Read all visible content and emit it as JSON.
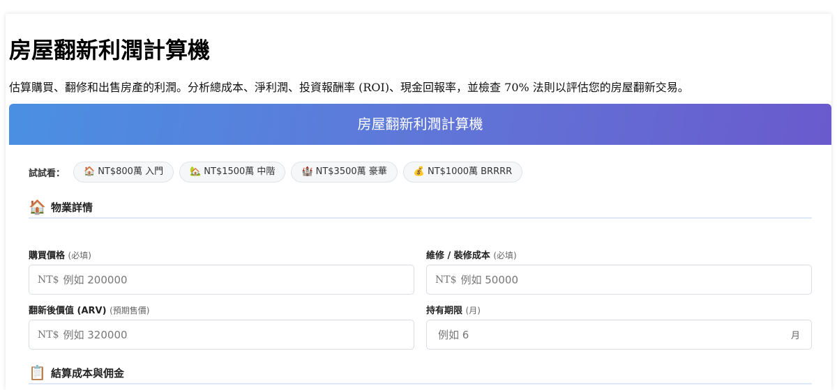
{
  "page": {
    "title": "房屋翻新利潤計算機",
    "description": "估算購買、翻修和出售房產的利潤。分析總成本、淨利潤、投資報酬率 (ROI)、現金回報率，並檢查 70% 法則以評估您的房屋翻新交易。"
  },
  "calculator": {
    "header_title": "房屋翻新利潤計算機",
    "try_label": "試試看：",
    "presets": [
      {
        "emoji": "🏠",
        "label": "NT$800萬 入門"
      },
      {
        "emoji": "🏡",
        "label": "NT$1500萬 中階"
      },
      {
        "emoji": "🏰",
        "label": "NT$3500萬 豪華"
      },
      {
        "emoji": "💰",
        "label": "NT$1000萬 BRRRR"
      }
    ],
    "sections": {
      "property": {
        "icon": "🏠",
        "title": "物業詳情"
      },
      "closing": {
        "icon": "📋",
        "title": "結算成本與佣金"
      }
    },
    "fields": {
      "purchase_price": {
        "label": "購買價格",
        "hint": "(必填)",
        "prefix": "NT$",
        "placeholder": "例如 200000",
        "value": ""
      },
      "repair_cost": {
        "label": "維修 / 裝修成本",
        "hint": "(必填)",
        "prefix": "NT$",
        "placeholder": "例如 50000",
        "value": ""
      },
      "arv": {
        "label": "翻新後價值 (ARV)",
        "hint": "(預期售價)",
        "prefix": "NT$",
        "placeholder": "例如 320000",
        "value": ""
      },
      "holding_period": {
        "label": "持有期限",
        "hint": "(月)",
        "suffix": "月",
        "placeholder": "例如 6",
        "value": ""
      }
    }
  }
}
